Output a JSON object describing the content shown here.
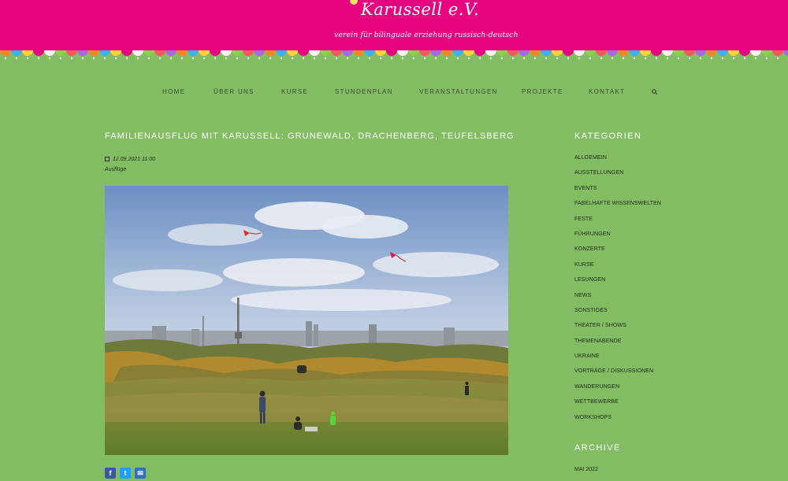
{
  "site": {
    "logo": "Karussell e.V.",
    "tagline": "verein für bilinguale erziehung russisch-deutsch"
  },
  "colors": {
    "header": "#e6057e",
    "background": "#82bd64",
    "facebook": "#3b5998",
    "twitter": "#1da1f2",
    "email": "#2f6fbd"
  },
  "nav": {
    "items": [
      "HOME",
      "ÜBER UNS",
      "KURSE",
      "STUNDENPLAN",
      "VERANSTALTUNGEN",
      "PROJEKTE",
      "KONTAKT"
    ],
    "search_icon": "search-icon"
  },
  "post": {
    "title": "FAMILIENAUSFLUG MIT KARUSSELL: GRUNEWALD, DRACHENBERG, TEUFELSBERG",
    "date": "12.09.2021 11:00",
    "category": "Ausflüge"
  },
  "share": {
    "facebook": "f",
    "twitter": "t",
    "email": "✉"
  },
  "sidebar": {
    "categories_title": "KATEGORIEN",
    "categories": [
      "ALLGEMEIN",
      "AUSSTELLUNGEN",
      "EVENTS",
      "FABELHAFTE WISSENSWELTEN",
      "FESTE",
      "FÜHRUNGEN",
      "KONZERTE",
      "KURSE",
      "LESUNGEN",
      "NEWS",
      "SONSTIGES",
      "THEATER / SHOWS",
      "THEMENABENDE",
      "UKRAINE",
      "VORTRÄGE / DISKUSSIONEN",
      "WANDERUNGEN",
      "WETTBEWERBE",
      "WORKSHOPS"
    ],
    "archive_title": "ARCHIVE",
    "archive": [
      "MAI 2022"
    ]
  }
}
